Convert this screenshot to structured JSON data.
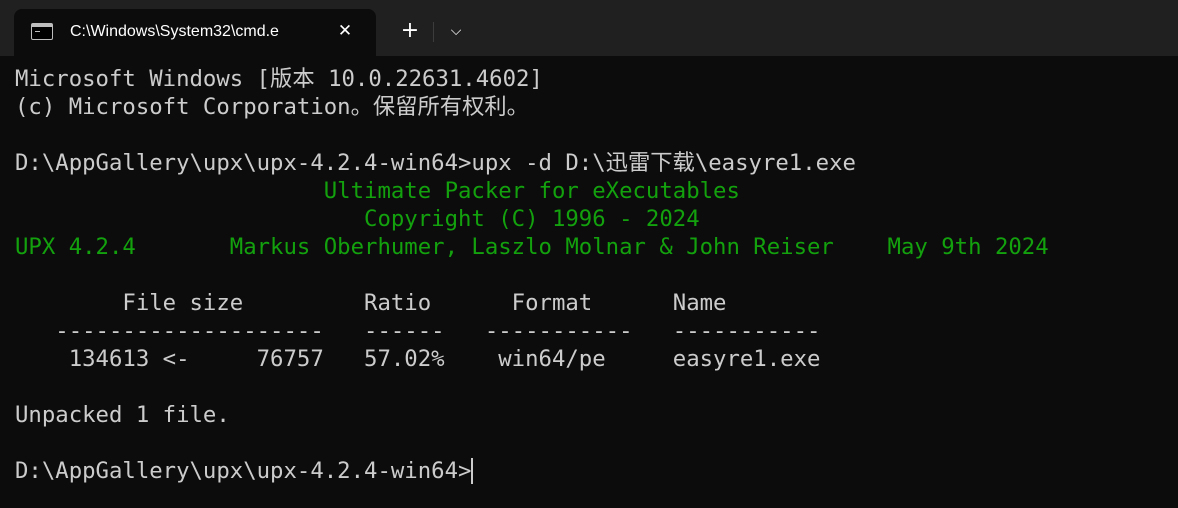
{
  "tab": {
    "title": "C:\\Windows\\System32\\cmd.e",
    "icon": "cmd-icon",
    "close_icon": "close-icon"
  },
  "toolbar": {
    "new_tab_icon": "+",
    "dropdown_icon": "⌵"
  },
  "colors": {
    "background": "#0c0c0c",
    "titlebar": "#202020",
    "text": "#cccccc",
    "accent_green": "#13a10e"
  },
  "console": {
    "lines": [
      {
        "text": "Microsoft Windows [版本 10.0.22631.4602]",
        "color": "default"
      },
      {
        "text": "(c) Microsoft Corporation。保留所有权利。",
        "color": "default"
      },
      {
        "text": "",
        "color": "default"
      },
      {
        "text": "D:\\AppGallery\\upx\\upx-4.2.4-win64>upx -d D:\\迅雷下载\\easyre1.exe",
        "color": "default"
      },
      {
        "text": "                       Ultimate Packer for eXecutables",
        "color": "green"
      },
      {
        "text": "                          Copyright (C) 1996 - 2024",
        "color": "green"
      },
      {
        "text": "UPX 4.2.4       Markus Oberhumer, Laszlo Molnar & John Reiser    May 9th 2024",
        "color": "green"
      },
      {
        "text": "",
        "color": "default"
      },
      {
        "text": "        File size         Ratio      Format      Name",
        "color": "default"
      },
      {
        "text": "   --------------------   ------   -----------   -----------",
        "color": "default"
      },
      {
        "text": "    134613 <-     76757   57.02%    win64/pe     easyre1.exe",
        "color": "default"
      },
      {
        "text": "",
        "color": "default"
      },
      {
        "text": "Unpacked 1 file.",
        "color": "default"
      },
      {
        "text": "",
        "color": "default"
      },
      {
        "text": "D:\\AppGallery\\upx\\upx-4.2.4-win64>",
        "color": "default",
        "cursor": true
      }
    ]
  }
}
